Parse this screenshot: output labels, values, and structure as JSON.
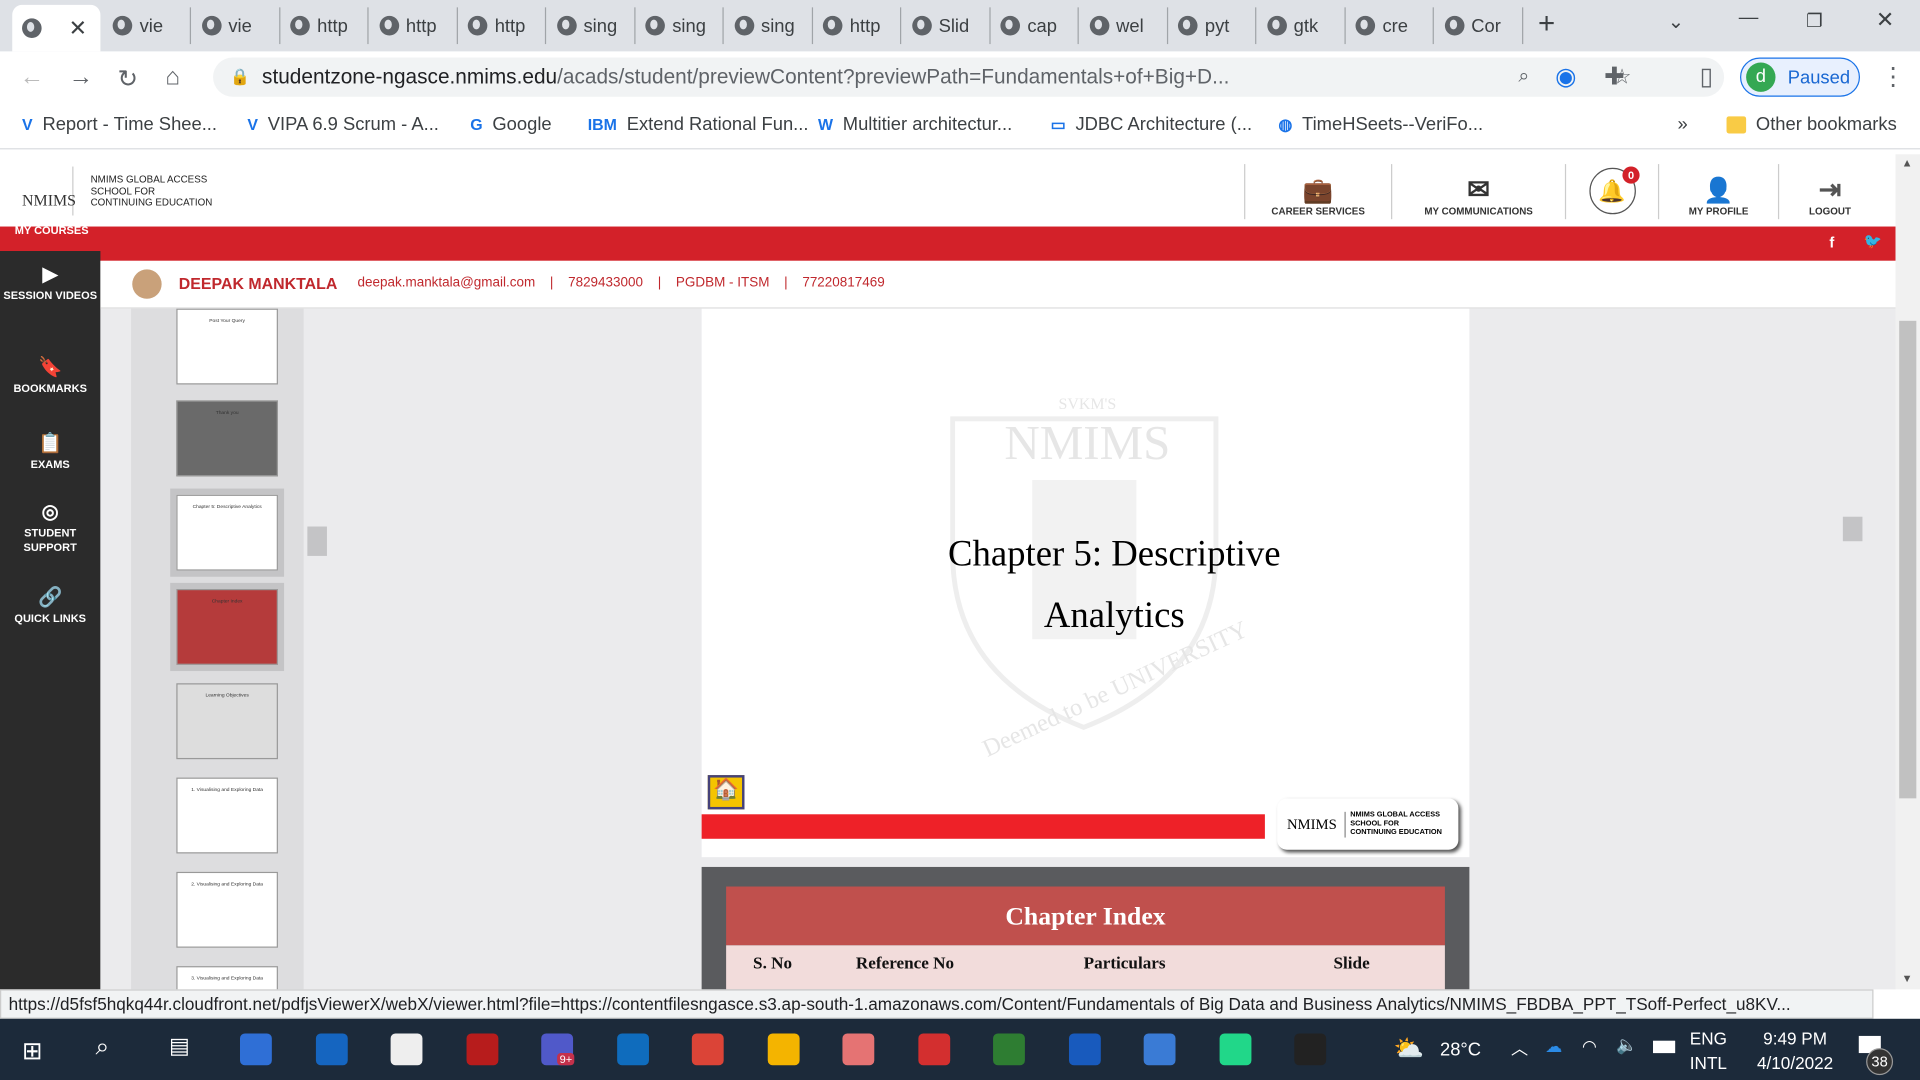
{
  "browser": {
    "tabs": [
      "vie",
      "vie",
      "http",
      "http",
      "http",
      "sing",
      "sing",
      "sing",
      "http",
      "Slid",
      "cap",
      "wel",
      "pyt",
      "gtk",
      "cre",
      "Cor"
    ],
    "url_host": "studentzone-ngasce.nmims.edu",
    "url_path": "/acads/student/previewContent?previewPath=Fundamentals+of+Big+D...",
    "profile": "Paused",
    "profile_initial": "d",
    "bookmarks": [
      "Report - Time Shee...",
      "VIPA 6.9 Scrum - A...",
      "Google",
      "Extend Rational Fun...",
      "Multitier architectur...",
      "JDBC Architecture (...",
      "TimeHSeets--VeriFo..."
    ],
    "other_bookmarks": "Other bookmarks",
    "more": "»"
  },
  "site": {
    "logo_text": "NMIMS",
    "school": [
      "NMIMS GLOBAL ACCESS",
      "SCHOOL FOR",
      "CONTINUING EDUCATION"
    ],
    "nav": [
      "CAREER SERVICES",
      "MY COMMUNICATIONS",
      "MY PROFILE",
      "LOGOUT"
    ],
    "notifications": "0",
    "my_courses": "MY COURSES",
    "sidebar": [
      "SESSION VIDEOS",
      "BOOKMARKS",
      "EXAMS",
      "STUDENT SUPPORT",
      "QUICK LINKS"
    ],
    "user": {
      "name": "DEEPAK MANKTALA",
      "email": "deepak.manktala@gmail.com",
      "phone": "7829433000",
      "program": "PGDBM - ITSM",
      "id": "77220817469"
    }
  },
  "slide": {
    "title_line1": "Chapter 5: Descriptive",
    "title_line2": "Analytics",
    "watermark_top": "SVKM'S",
    "watermark_main": "NMIMS",
    "watermark_arc": "Deemed to be UNIVERSITY",
    "footer_logo": "NMIMS",
    "footer_school": [
      "NMIMS GLOBAL ACCESS",
      "SCHOOL FOR",
      "CONTINUING EDUCATION"
    ]
  },
  "slide2": {
    "title": "Chapter Index",
    "columns": [
      "S. No",
      "Reference No",
      "Particulars",
      "Slide"
    ]
  },
  "thumbnails": [
    "Post Your Query",
    "Thank you",
    "Chapter 5: Descriptive Analytics",
    "Chapter Index",
    "Learning Objectives",
    "1. Visualising and Exploring Data",
    "2. Visualising and Exploring Data",
    "3. Visualising and Exploring Data"
  ],
  "status_url": "https://d5fsf5hqkq44r.cloudfront.net/pdfjsViewerX/webX/viewer.html?file=https://contentfilesngasce.s3.ap-south-1.amazonaws.com/Content/Fundamentals of Big Data and Business Analytics/NMIMS_FBDBA_PPT_TSoff-Perfect_u8KV...",
  "taskbar": {
    "temp": "28°C",
    "lang1": "ENG",
    "lang2": "INTL",
    "time": "9:49 PM",
    "date": "4/10/2022",
    "notif": "38",
    "teams_badge": "9+"
  },
  "colors": {
    "red": "#d32129",
    "sidebar": "#2b2b2b",
    "taskbar": "#1c2a3a"
  }
}
